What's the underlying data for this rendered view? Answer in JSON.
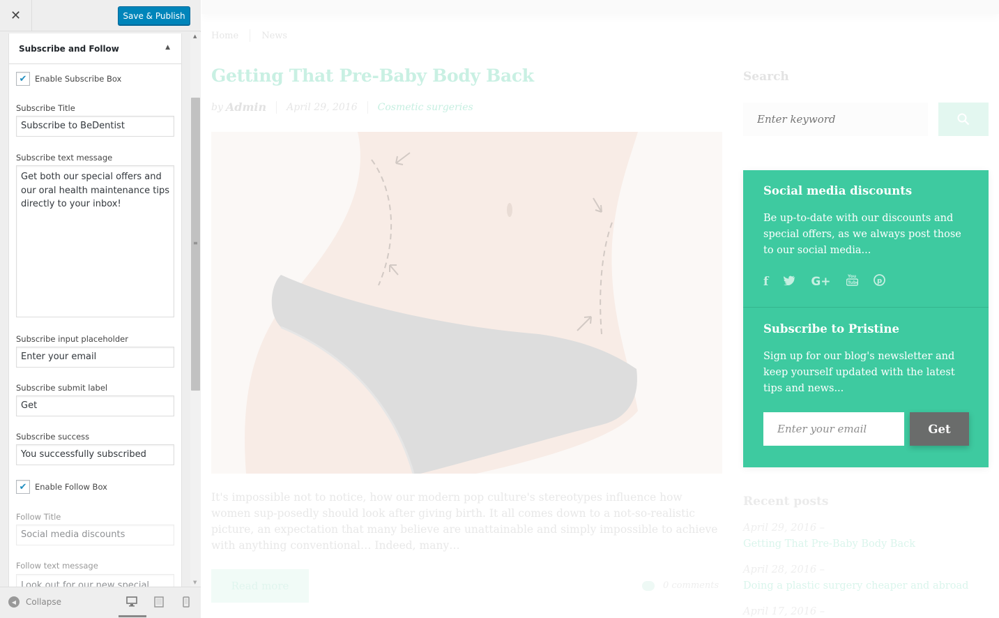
{
  "customizer": {
    "close_icon": "close-icon",
    "publish_label": "Save & Publish",
    "section_title": "Subscribe and Follow",
    "fields": {
      "enable_subscribe_label": "Enable Subscribe Box",
      "enable_subscribe_checked": true,
      "subscribe_title_label": "Subscribe Title",
      "subscribe_title_value": "Subscribe to BeDentist",
      "subscribe_text_label": "Subscribe text message",
      "subscribe_text_value": "Get both our special offers and our oral health maintenance tips directly to your inbox!",
      "subscribe_placeholder_label": "Subscribe input placeholder",
      "subscribe_placeholder_value": "Enter your email",
      "subscribe_submit_label": "Subscribe submit label",
      "subscribe_submit_value": "Get",
      "subscribe_success_label": "Subscribe success",
      "subscribe_success_value": "You successfully subscribed",
      "enable_follow_label": "Enable Follow Box",
      "enable_follow_checked": true,
      "follow_title_label": "Follow Title",
      "follow_title_value": "Social media discounts",
      "follow_text_label": "Follow text message",
      "follow_text_value": "Look out for our new special"
    },
    "footer": {
      "collapse_label": "Collapse",
      "devices": [
        "desktop-icon",
        "tablet-icon",
        "mobile-icon"
      ],
      "active_device": "desktop"
    }
  },
  "preview": {
    "breadcrumb": [
      "Home",
      "News"
    ],
    "post": {
      "title": "Getting That Pre-Baby Body Back",
      "by": "by",
      "author": "Admin",
      "date": "April 29, 2016",
      "category": "Cosmetic surgeries",
      "excerpt": "It's impossible not to notice, how our modern pop culture's stereotypes influence how women sup-posedly should look after giving birth. It all comes down to a not-so-realistic picture, an expectation that many believe are unattainable and simply impossible to achieve with anything conventional… Indeed, many…",
      "read_more": "Read more",
      "comments": "0 comments"
    },
    "sidebar": {
      "search_title": "Search",
      "search_placeholder": "Enter keyword",
      "widget": {
        "follow_title": "Social media discounts",
        "follow_text": "Be up-to-date with our discounts and special offers, as we always post those to our social media...",
        "social_icons": [
          "facebook-icon",
          "twitter-icon",
          "google-plus-icon",
          "youtube-icon",
          "pinterest-icon"
        ],
        "subscribe_title": "Subscribe to Pristine",
        "subscribe_text": "Sign up for our blog's newsletter and keep yourself updated with the latest tips and news...",
        "email_placeholder": "Enter your email",
        "submit_label": "Get",
        "accent_color": "#3ecaa0",
        "button_color": "#6a6c6b"
      },
      "recent_title": "Recent posts",
      "recent_posts": [
        {
          "date": "April 29, 2016 –",
          "title": "Getting That Pre-Baby Body Back"
        },
        {
          "date": "April 28, 2016 –",
          "title": "Doing a plastic surgery cheaper and abroad"
        },
        {
          "date": "April 17, 2016 –",
          "title": ""
        }
      ]
    }
  }
}
